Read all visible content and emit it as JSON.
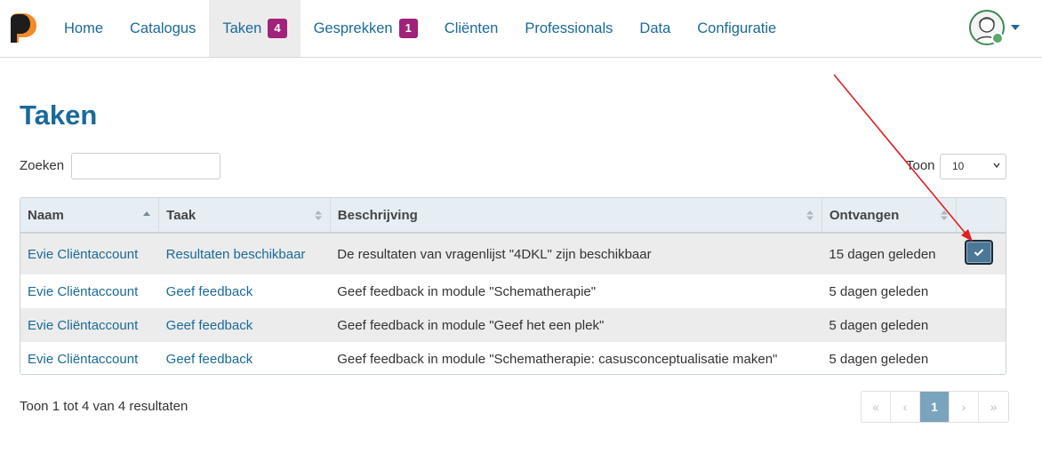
{
  "nav": {
    "items": [
      {
        "label": "Home"
      },
      {
        "label": "Catalogus"
      },
      {
        "label": "Taken",
        "badge": "4"
      },
      {
        "label": "Gesprekken",
        "badge": "1"
      },
      {
        "label": "Cliënten"
      },
      {
        "label": "Professionals"
      },
      {
        "label": "Data"
      },
      {
        "label": "Configuratie"
      }
    ],
    "active_index": 2
  },
  "page": {
    "title": "Taken"
  },
  "search": {
    "label": "Zoeken",
    "value": ""
  },
  "length": {
    "label": "Toon",
    "value": "10"
  },
  "table": {
    "columns": [
      "Naam",
      "Taak",
      "Beschrijving",
      "Ontvangen"
    ],
    "rows": [
      {
        "naam": "Evie Cliëntaccount",
        "taak": "Resultaten beschikbaar",
        "beschrijving": "De resultaten van vragenlijst \"4DKL\" zijn beschikbaar",
        "ontvangen": "15 dagen geleden"
      },
      {
        "naam": "Evie Cliëntaccount",
        "taak": "Geef feedback",
        "beschrijving": "Geef feedback in module \"Schematherapie\"",
        "ontvangen": "5 dagen geleden"
      },
      {
        "naam": "Evie Cliëntaccount",
        "taak": "Geef feedback",
        "beschrijving": "Geef feedback in module \"Geef het een plek\"",
        "ontvangen": "5 dagen geleden"
      },
      {
        "naam": "Evie Cliëntaccount",
        "taak": "Geef feedback",
        "beschrijving": "Geef feedback in module \"Schematherapie: casusconceptualisatie maken\"",
        "ontvangen": "5 dagen geleden"
      }
    ]
  },
  "footer": {
    "info": "Toon 1 tot 4 van 4 resultaten",
    "pagination": {
      "first": "«",
      "prev": "‹",
      "current": "1",
      "next": "›",
      "last": "»"
    }
  },
  "colors": {
    "brand": "#1a6a99",
    "badge": "#a0227a",
    "accent_orange": "#f28c28",
    "annotation_arrow": "#e02020"
  },
  "icons": {
    "logo": "brand-logo-icon",
    "avatar": "user-avatar-icon",
    "caret": "chevron-down-icon",
    "check": "check-icon",
    "sort": "sort-icon"
  }
}
